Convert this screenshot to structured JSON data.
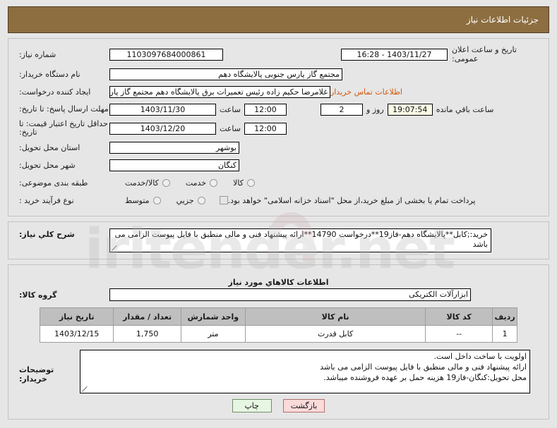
{
  "header": {
    "title": "جزئیات اطلاعات نیاز"
  },
  "form": {
    "need_number_label": "شماره نیاز:",
    "need_number_value": "1103097684000861",
    "announce_label": "تاریخ و ساعت اعلان عمومی:",
    "announce_value": "1403/11/27 - 16:28",
    "buyer_org_label": "نام دستگاه خریدار:",
    "buyer_org_value": "مجتمع گاز پارس جنوبی  پالایشگاه دهم",
    "requester_label": "ایجاد کننده درخواست:",
    "requester_value": "غلامرضا حکیم زاده رئیس تعمیرات برق پالایشگاه دهم  مجتمع گاز پارس جنوبی",
    "contact_link": "اطلاعات تماس خریدار",
    "deadline_label": "مهلت ارسال پاسخ: تا تاریخ:",
    "deadline_date": "1403/11/30",
    "deadline_hour_label": "ساعت",
    "deadline_hour": "12:00",
    "remaining_days": "2",
    "remaining_days_label": "روز و",
    "remaining_time": "19:07:54",
    "remaining_time_label": "ساعت باقي مانده",
    "price_validity_label": "حداقل تاریخ اعتبار قیمت: تا تاریخ:",
    "price_validity_date": "1403/12/20",
    "price_validity_hour_label": "ساعت",
    "price_validity_hour": "12:00",
    "province_label": "استان محل تحویل:",
    "province_value": "بوشهر",
    "city_label": "شهر محل تحویل:",
    "city_value": "کنگان",
    "classification_label": "طبقه بندی موضوعی:",
    "classification_options": [
      "کالا",
      "خدمت",
      "کالا/خدمت"
    ],
    "process_type_label": "نوع فرآیند خرید :",
    "process_type_options": [
      "جزیي",
      "متوسط"
    ],
    "treasury_checkbox_label": "پرداخت تمام یا بخشی از مبلغ خرید،از محل \"اسناد خزانه اسلامی\" خواهد بود."
  },
  "description": {
    "label": "شرح كلي نياز:",
    "value": "خرید:;کابل**پالایشگاه دهم-فاز19**درخواست 14790**ارائه پیشنهاد فنی و مالی منطبق با فایل پیوست الزامی می باشد"
  },
  "items_section": {
    "title": "اطلاعات كالاهاي مورد نياز",
    "group_label": "گروه کالا:",
    "group_value": "ابزارآلات الکتریکی",
    "columns": [
      "ردیف",
      "کد کالا",
      "نام کالا",
      "واحد شمارش",
      "تعداد / مقدار",
      "تاریخ نیاز"
    ],
    "rows": [
      {
        "radif": "1",
        "code": "--",
        "name": "کابل قدرت",
        "unit": "متر",
        "qty": "1,750",
        "date": "1403/12/15"
      }
    ]
  },
  "buyer_notes": {
    "label": "توضیحات خریدار:",
    "line1": "اولویت با ساخت داخل است.",
    "line2": "ارائه پیشنهاد فنی و مالی منطبق با فایل پیوست الزامی می باشد",
    "line3": "محل تحویل:کنگان-فاز19 هزینه حمل بر عهده فروشنده میباشد."
  },
  "footer": {
    "print_label": "چاپ",
    "back_label": "بازگشت"
  },
  "watermark": {
    "text": "iritender.net"
  },
  "colors": {
    "header_bg": "#8d6e41",
    "page_bg": "#e6e6e6",
    "link": "#d2590f",
    "table_header_bg": "#bfbfbf",
    "countdown_bg": "#fbfbe7",
    "print_btn_bg": "#e7f6e2",
    "back_btn_bg": "#fbdada"
  }
}
